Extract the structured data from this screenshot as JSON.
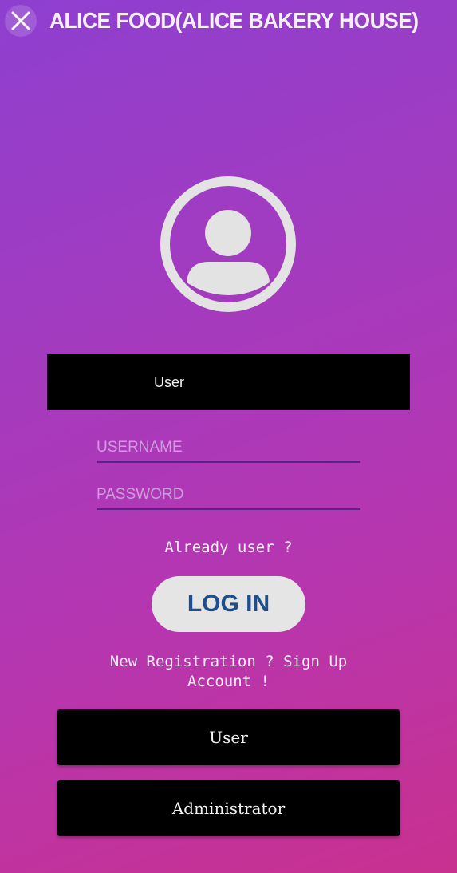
{
  "header": {
    "close_icon": "close-icon",
    "title": "ALICE FOOD(ALICE BAKERY HOUSE)"
  },
  "avatar": {
    "icon": "user-avatar-icon",
    "color": "#e3e3e3"
  },
  "role_bar": {
    "label": "User"
  },
  "form": {
    "username_placeholder": "USERNAME",
    "username_value": "",
    "password_placeholder": "PASSWORD",
    "password_value": ""
  },
  "login": {
    "prompt": "Already user ?",
    "button_label": "LOG IN"
  },
  "register": {
    "line1": "New Registration ? Sign Up",
    "line2": "Account !"
  },
  "buttons": {
    "user_label": "User",
    "admin_label": "Administrator"
  },
  "colors": {
    "gradient_start": "#8e3fd0",
    "gradient_end": "#c9318f",
    "login_text": "#1f4e8c",
    "button_bg": "#000000"
  }
}
